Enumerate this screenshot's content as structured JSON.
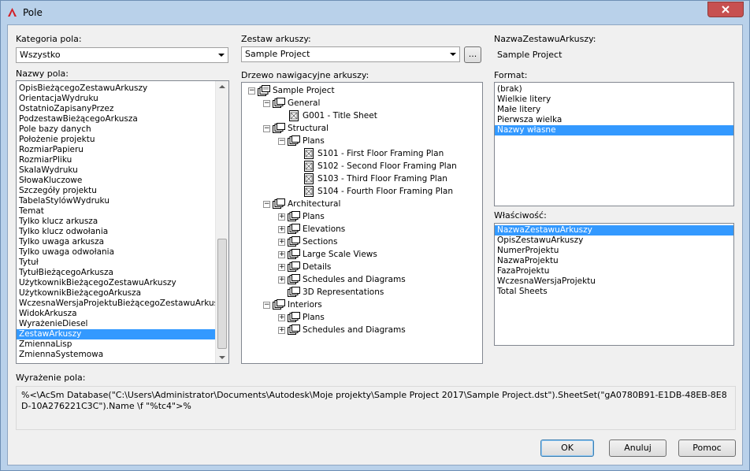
{
  "window": {
    "title": "Pole"
  },
  "field_category": {
    "label": "Kategoria pola:",
    "value": "Wszystko"
  },
  "field_names": {
    "label": "Nazwy pola:",
    "items": [
      "OpisBieżącegoZestawuArkuszy",
      "OrientacjaWydruku",
      "OstatnioZapisanyPrzez",
      "PodzestawBieżącegoArkusza",
      "Pole bazy danych",
      "Położenie projektu",
      "RozmiarPapieru",
      "RozmiarPliku",
      "SkalaWydruku",
      "SłowaKluczowe",
      "Szczegóły projektu",
      "TabelaStylówWydruku",
      "Temat",
      "Tylko klucz arkusza",
      "Tylko klucz odwołania",
      "Tylko uwaga arkusza",
      "Tylko uwaga odwołania",
      "Tytuł",
      "TytułBieżącegoArkusza",
      "UżytkownikBieżącegoZestawuArkuszy",
      "UżytkownikBieżącegoArkusza",
      "WczesnaWersjaProjektuBieżącegoZestawuArkuszy",
      "WidokArkusza",
      "WyrażenieDiesel",
      "ZestawArkuszy",
      "ZmiennaLisp",
      "ZmiennaSystemowa"
    ],
    "selected": "ZestawArkuszy"
  },
  "sheet_set": {
    "label": "Zestaw arkuszy:",
    "value": "Sample Project",
    "browse_label": "..."
  },
  "nav_tree": {
    "label": "Drzewo nawigacyjne arkuszy:",
    "rows": [
      {
        "text": "Sample Project",
        "indent": 0,
        "expander": "−",
        "icon": "sheet-set-icon"
      },
      {
        "text": "General",
        "indent": 1,
        "expander": "−",
        "icon": "subset-icon"
      },
      {
        "text": "G001 - Title Sheet",
        "indent": 2,
        "expander": "",
        "icon": "sheet-icon"
      },
      {
        "text": "Structural",
        "indent": 1,
        "expander": "−",
        "icon": "subset-icon"
      },
      {
        "text": "Plans",
        "indent": 2,
        "expander": "−",
        "icon": "subset-icon"
      },
      {
        "text": "S101 - First Floor Framing Plan",
        "indent": 3,
        "expander": "",
        "icon": "sheet-icon"
      },
      {
        "text": "S102 - Second Floor Framing Plan",
        "indent": 3,
        "expander": "",
        "icon": "sheet-icon"
      },
      {
        "text": "S103 - Third Floor Framing Plan",
        "indent": 3,
        "expander": "",
        "icon": "sheet-icon"
      },
      {
        "text": "S104 - Fourth Floor Framing Plan",
        "indent": 3,
        "expander": "",
        "icon": "sheet-icon"
      },
      {
        "text": "Architectural",
        "indent": 1,
        "expander": "−",
        "icon": "subset-icon"
      },
      {
        "text": "Plans",
        "indent": 2,
        "expander": "+",
        "icon": "subset-icon"
      },
      {
        "text": "Elevations",
        "indent": 2,
        "expander": "+",
        "icon": "subset-icon"
      },
      {
        "text": "Sections",
        "indent": 2,
        "expander": "+",
        "icon": "subset-icon"
      },
      {
        "text": "Large Scale Views",
        "indent": 2,
        "expander": "+",
        "icon": "subset-icon"
      },
      {
        "text": "Details",
        "indent": 2,
        "expander": "+",
        "icon": "subset-icon"
      },
      {
        "text": "Schedules and Diagrams",
        "indent": 2,
        "expander": "+",
        "icon": "subset-icon"
      },
      {
        "text": "3D Representations",
        "indent": 2,
        "expander": "",
        "icon": "subset-icon"
      },
      {
        "text": "Interiors",
        "indent": 1,
        "expander": "−",
        "icon": "subset-icon"
      },
      {
        "text": "Plans",
        "indent": 2,
        "expander": "+",
        "icon": "subset-icon"
      },
      {
        "text": "Schedules and Diagrams",
        "indent": 2,
        "expander": "+",
        "icon": "subset-icon"
      }
    ]
  },
  "sheet_set_name": {
    "label": "NazwaZestawuArkuszy:",
    "value": "Sample Project"
  },
  "format": {
    "label": "Format:",
    "items": [
      "(brak)",
      "Wielkie litery",
      "Małe litery",
      "Pierwsza wielka",
      "Nazwy własne"
    ],
    "selected": "Nazwy własne"
  },
  "properties": {
    "label": "Właściwość:",
    "items": [
      "NazwaZestawuArkuszy",
      "OpisZestawuArkuszy",
      "NumerProjektu",
      "NazwaProjektu",
      "FazaProjektu",
      "WczesnaWersjaProjektu",
      "Total Sheets"
    ],
    "selected": "NazwaZestawuArkuszy"
  },
  "expression": {
    "label": "Wyrażenie pola:",
    "value": "%<\\AcSm Database(\"C:\\Users\\Administrator\\Documents\\Autodesk\\Moje projekty\\Sample Project 2017\\Sample Project.dst\").SheetSet(\"gA0780B91-E1DB-48EB-8E8D-10A276221C3C\").Name \\f \"%tc4\">%"
  },
  "buttons": {
    "ok": "OK",
    "cancel": "Anuluj",
    "help": "Pomoc"
  },
  "colors": {
    "selection": "#3399ff",
    "close": "#c75050"
  }
}
